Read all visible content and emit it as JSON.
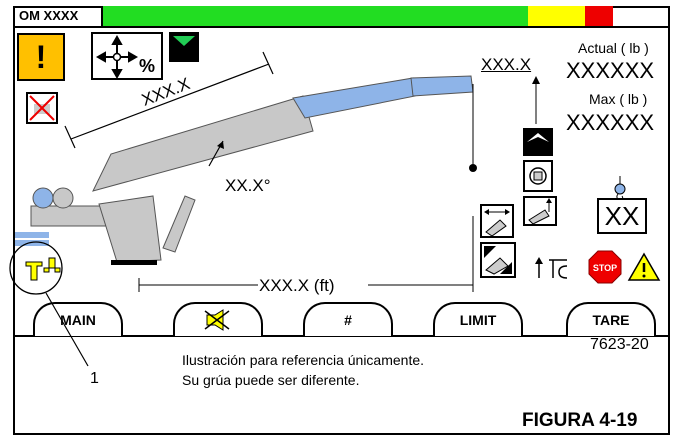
{
  "display": {
    "model_label": "OM XXXX",
    "load_bar": {
      "green_fraction": 0.75,
      "yellow_fraction": 0.1,
      "red_fraction": 0.05
    },
    "colors": {
      "green": "#22dd22",
      "yellow": "#ffff00",
      "red": "#ee0000",
      "warning_orange": "#ffc000",
      "boom": "#c8c8c8",
      "jib": "#8eb4e8"
    },
    "boom_length": "XXX.X",
    "boom_angle": "XX.X°",
    "radius": "XXX.X (ft)",
    "hook_height": "XXX.X",
    "load": {
      "actual_label": "Actual ( lb )",
      "actual_value": "XXXXXX",
      "max_label": "Max ( lb )",
      "max_value": "XXXXXX"
    },
    "parts_of_line": "XX",
    "buttons": {
      "main": "MAIN",
      "mute_icon": "speaker-muted",
      "hash": "#",
      "limit": "LIMIT",
      "tare": "TARE"
    }
  },
  "caption": {
    "code": "7623-20",
    "note_line1": "Ilustración para referencia únicamente.",
    "note_line2": "Su grúa puede ser diferente.",
    "callout": "1",
    "figure": "FIGURA 4-19"
  }
}
